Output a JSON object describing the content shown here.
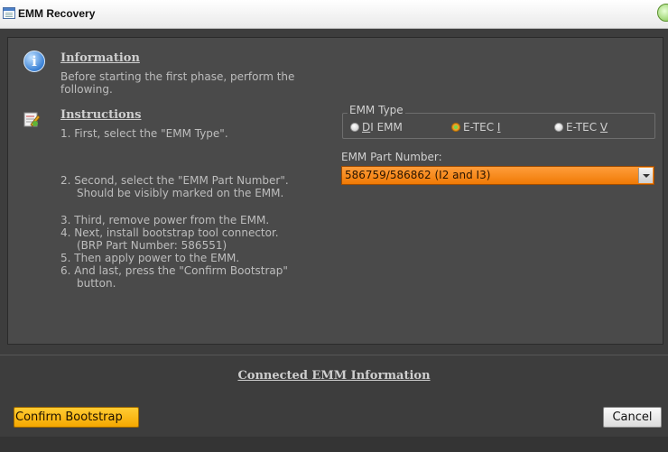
{
  "window": {
    "title": "EMM Recovery"
  },
  "information": {
    "heading": "Information",
    "line1": "Before starting the first phase, perform the",
    "line2": "following."
  },
  "instructions": {
    "heading": "Instructions",
    "step1": "1. First, select the \"EMM Type\".",
    "step2_line1": "2. Second, select the \"EMM Part Number\".",
    "step2_line2": "Should be visibly marked on the EMM.",
    "step3": "3. Third, remove power from the EMM.",
    "step4_line1": "4. Next, install bootstrap tool connector.",
    "step4_line2": "(BRP Part Number: 586551)",
    "step5": "5. Then apply power to the EMM.",
    "step6_line1": "6. And last, press the \"Confirm Bootstrap\"",
    "step6_line2": "button."
  },
  "emm_type": {
    "legend": "EMM Type",
    "options": [
      {
        "prefix": "",
        "mnemonic": "D",
        "suffix": "I EMM",
        "selected": false
      },
      {
        "prefix": "E-TEC ",
        "mnemonic": "I",
        "suffix": "",
        "selected": true
      },
      {
        "prefix": "E-TEC ",
        "mnemonic": "V",
        "suffix": "",
        "selected": false
      }
    ]
  },
  "part_number": {
    "label": "EMM Part Number:",
    "value": "586759/586862 (I2 and I3)"
  },
  "connected_info": {
    "label": "Connected EMM Information"
  },
  "buttons": {
    "confirm": "Confirm Bootstrap",
    "cancel": "Cancel"
  },
  "colors": {
    "accent_orange": "#f07a05",
    "button_yellow": "#f5a800",
    "background": "#3d3d3d"
  }
}
